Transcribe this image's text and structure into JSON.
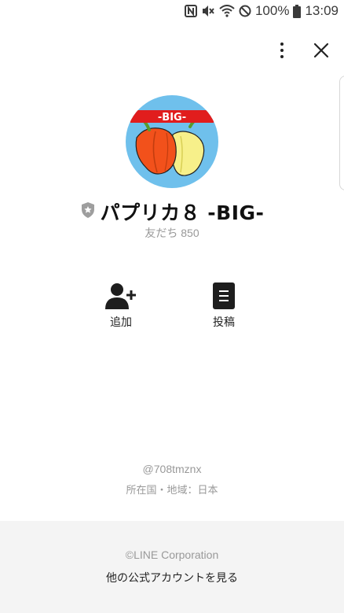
{
  "status_bar": {
    "battery_percent": "100%",
    "time": "13:09"
  },
  "profile": {
    "logo_text": "-BIG-",
    "account_name": "パプリカ８ -BIG-",
    "friends_count": "友だち 850"
  },
  "actions": {
    "add_label": "追加",
    "post_label": "投稿"
  },
  "info": {
    "account_id": "@708tmznx",
    "region": "所在国・地域：日本"
  },
  "footer": {
    "copyright": "©LINE Corporation",
    "other_accounts_link": "他の公式アカウントを見る"
  },
  "colors": {
    "avatar_bg": "#6fc0ec",
    "logo_banner": "#e11d1d",
    "pepper_orange": "#f2511b",
    "pepper_yellow": "#f7f08a",
    "stem_green": "#5a9a2a",
    "badge_gray": "#9e9e9e"
  },
  "icons": [
    "nfc-icon",
    "mute-icon",
    "wifi-icon",
    "do-not-disturb-icon",
    "battery-icon",
    "more-vertical-icon",
    "close-icon",
    "verified-shield-icon",
    "add-friend-icon",
    "post-icon"
  ]
}
